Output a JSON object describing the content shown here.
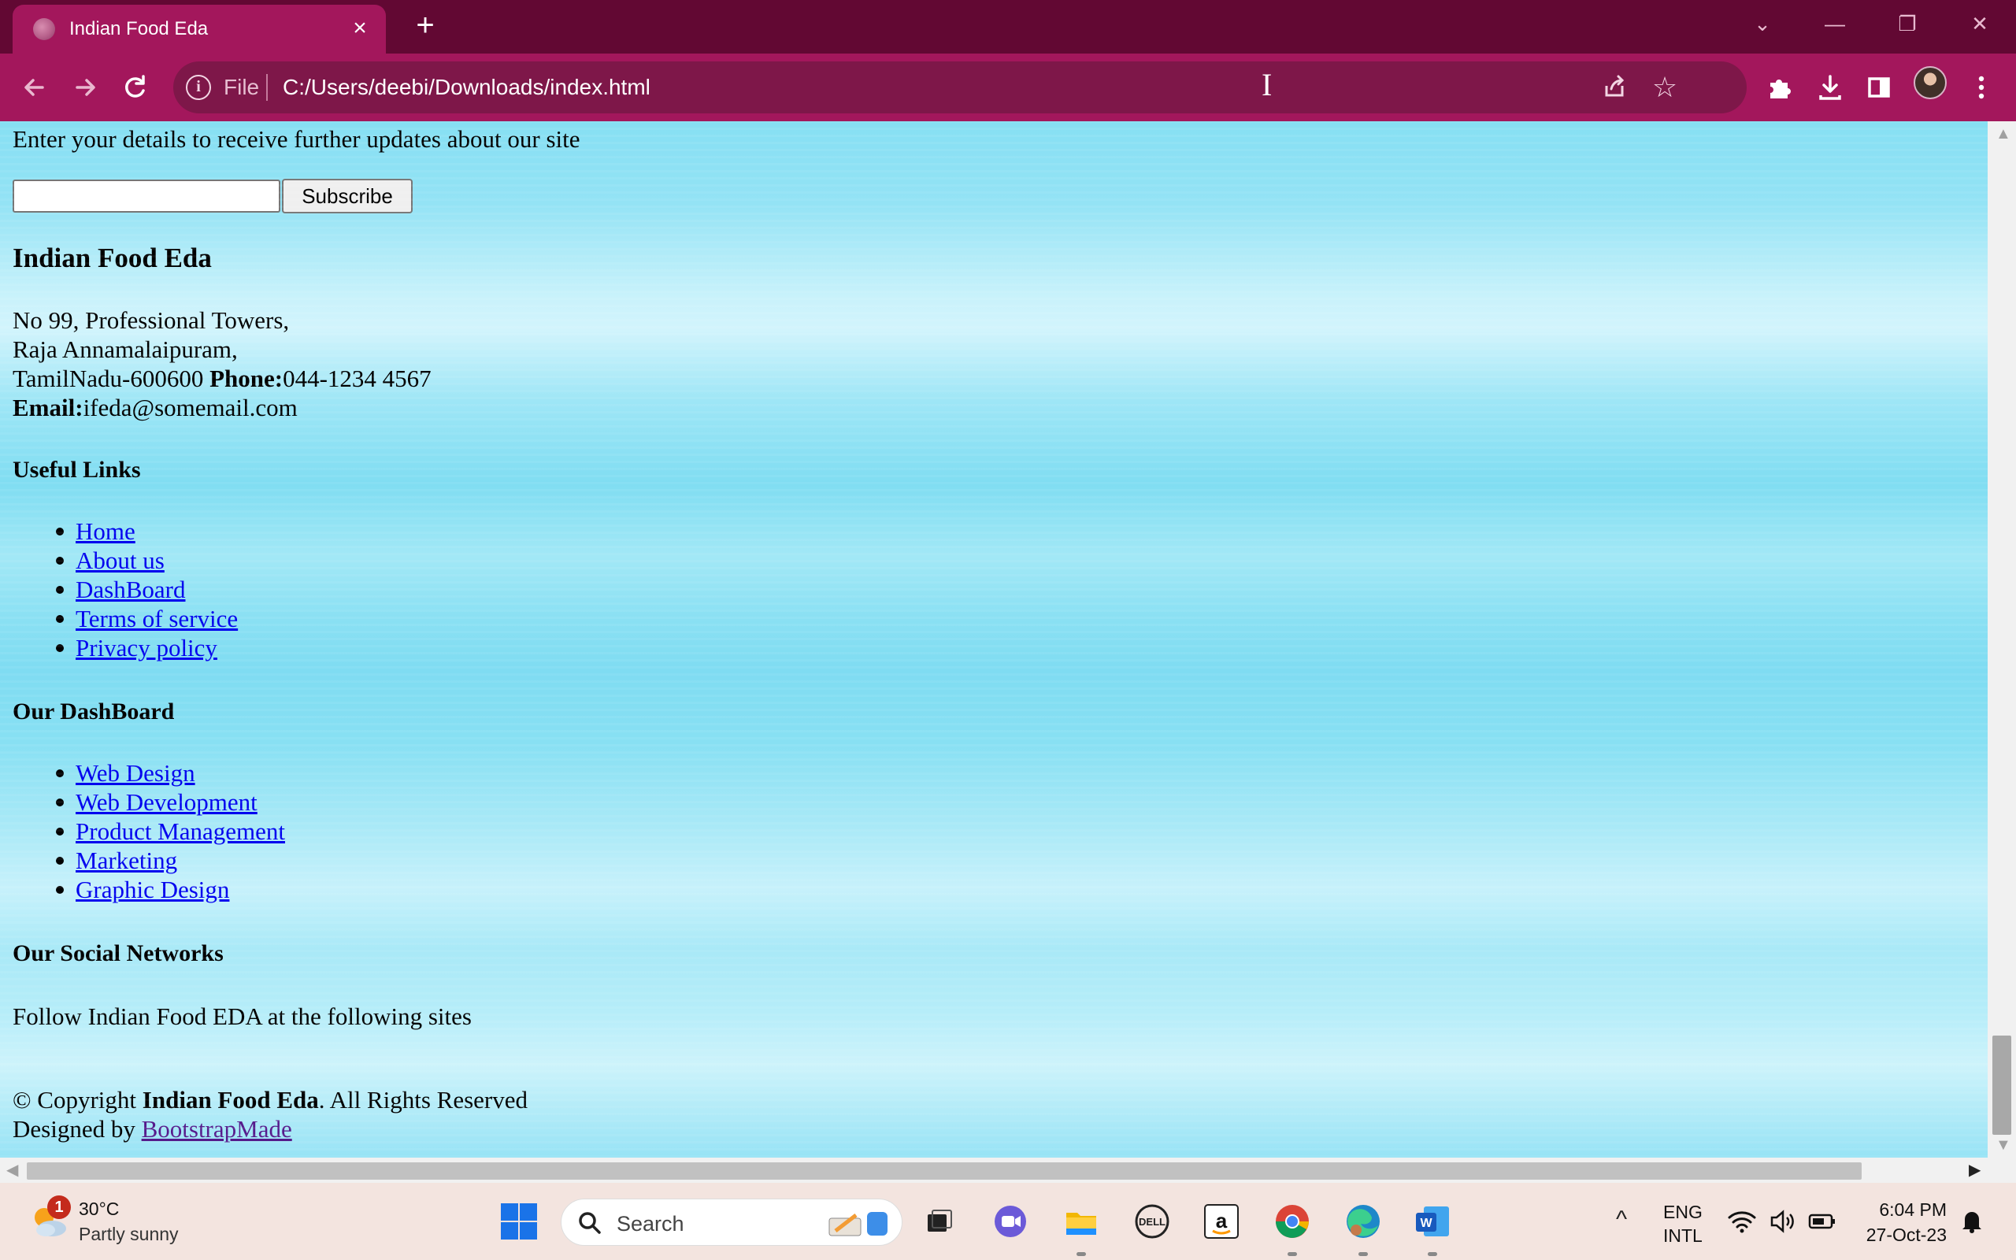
{
  "browser": {
    "tab_title": "Indian Food Eda",
    "address_scheme": "File",
    "address_url": "C:/Users/deebi/Downloads/index.html"
  },
  "page": {
    "subscribe_prompt": "Enter your details to receive further updates about our site",
    "email_value": "",
    "subscribe_button": "Subscribe",
    "site_name": "Indian Food Eda",
    "address_line1": "No 99, Professional Towers,",
    "address_line2": "Raja Annamalaipuram,",
    "address_line3": "TamilNadu-600600",
    "phone_label": "Phone:",
    "phone_value": "044-1234 4567",
    "email_label": "Email:",
    "email_address": "ifeda@somemail.com",
    "useful_links_heading": "Useful Links",
    "useful_links": [
      "Home",
      "About us",
      "DashBoard",
      "Terms of service",
      "Privacy policy"
    ],
    "dashboard_heading": "Our DashBoard",
    "dashboard_links": [
      "Web Design",
      "Web Development",
      "Product Management",
      "Marketing",
      "Graphic Design"
    ],
    "social_heading": "Our Social Networks",
    "social_text": "Follow Indian Food EDA at the following sites",
    "copyright_prefix": "© Copyright ",
    "copyright_name": "Indian Food Eda",
    "copyright_suffix": ". All Rights Reserved",
    "designed_by": "Designed by ",
    "designer_link": "BootstrapMade"
  },
  "taskbar": {
    "weather_badge": "1",
    "temperature": "30°C",
    "condition": "Partly sunny",
    "search_placeholder": "Search",
    "lang_line1": "ENG",
    "lang_line2": "INTL",
    "time": "6:04 PM",
    "date": "27-Oct-23"
  },
  "icons": {
    "back": "arrow-left-icon",
    "forward": "arrow-right-icon",
    "reload": "reload-icon",
    "share": "share-icon",
    "bookmark": "star-icon",
    "extensions": "puzzle-icon",
    "download": "download-icon",
    "sidepanel": "side-panel-icon",
    "menu": "kebab-menu-icon"
  },
  "colors": {
    "browser_frame": "#620833",
    "toolbar": "#a3175c",
    "link": "#0000ee",
    "visited_link": "#551a8b"
  }
}
